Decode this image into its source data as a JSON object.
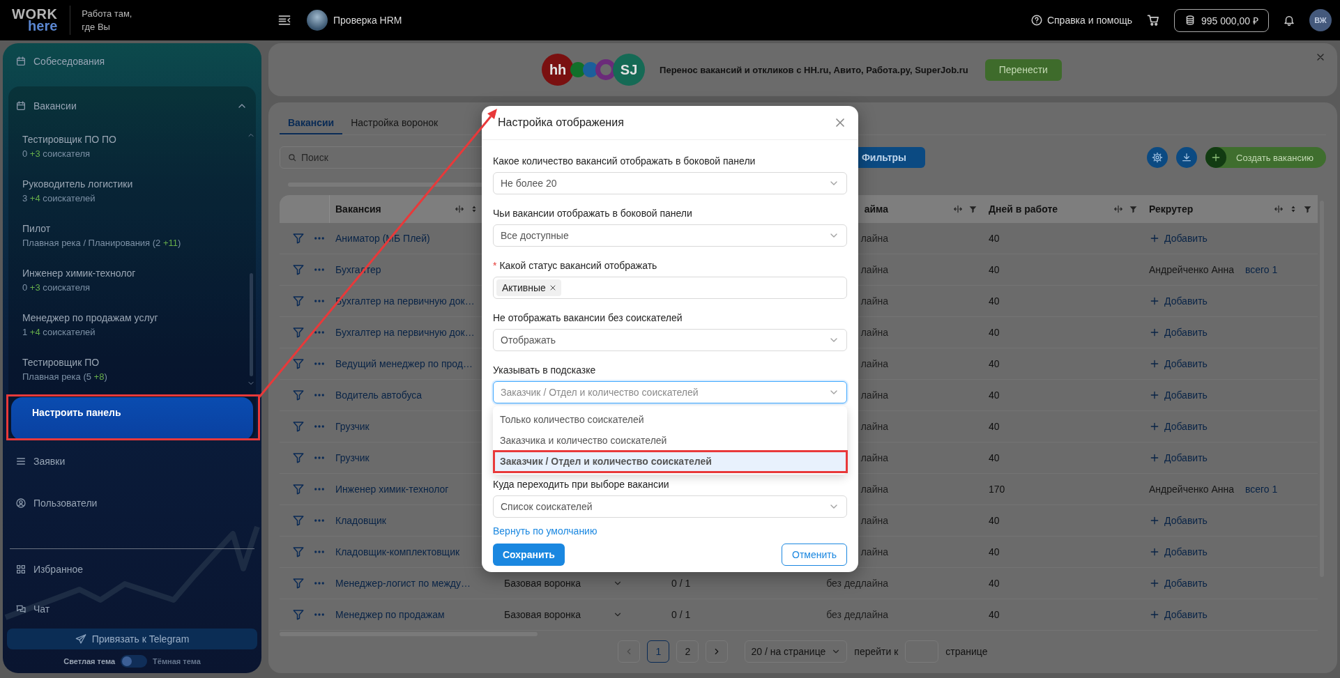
{
  "top_bar": {
    "logo": {
      "line1": "WORK",
      "line2": "here"
    },
    "slogan": [
      "Работа там,",
      "где Вы"
    ],
    "project": "Проверка HRM",
    "help": "Справка и помощь",
    "balance": "995 000,00 ₽",
    "avatar": "ВЖ"
  },
  "sidebar": {
    "items_top": [
      {
        "label": "Собеседования"
      }
    ],
    "group": {
      "label": "Вакансии",
      "expanded": true,
      "items": [
        {
          "title": "Тестировщик ПО ПО",
          "subtitle": {
            "before": "0 ",
            "added": "+3",
            "after": " соискателя"
          }
        },
        {
          "title": "Руководитель логистики",
          "subtitle": {
            "before": "3 ",
            "added": "+4",
            "after": " соискателей"
          }
        },
        {
          "title": "Пилот",
          "subtitle": {
            "before": "Плавная река / Планирования (2 ",
            "added": "+11",
            "after": ")"
          }
        },
        {
          "title": "Инженер химик-технолог",
          "subtitle": {
            "before": "0 ",
            "added": "+3",
            "after": " соискателя"
          }
        },
        {
          "title": "Менеджер по продажам услуг",
          "subtitle": {
            "before": "1 ",
            "added": "+4",
            "after": " соискателей"
          }
        },
        {
          "title": "Тестировщик ПО",
          "subtitle": {
            "before": "Плавная река (5 ",
            "added": "+8",
            "after": ")"
          }
        }
      ]
    },
    "configure_button": "Настроить панель",
    "items_bottom": [
      {
        "label": "Заявки"
      },
      {
        "label": "Пользователи"
      }
    ],
    "items_pinned": [
      {
        "label": "Избранное"
      },
      {
        "label": "Чат"
      }
    ],
    "telegram_button": "Привязать к Telegram",
    "theme": {
      "light_label": "Светлая тема",
      "dark_label": "Тёмная тема",
      "dark": false
    }
  },
  "banner": {
    "logos": [
      {
        "kind": "badge",
        "text": "hh",
        "color": "#7a1010"
      },
      {
        "kind": "dot",
        "color": "#12702a"
      },
      {
        "kind": "dot",
        "color": "#1b5f9b"
      },
      {
        "kind": "ring",
        "color": "#6b2a7a"
      },
      {
        "kind": "badge",
        "text": "SJ",
        "color": "#156a55"
      }
    ],
    "text": "Перенос вакансий и откликов с HH.ru, Авито, Работа.ру, SuperJob.ru",
    "button": "Перенести"
  },
  "tabs": [
    {
      "label": "Вакансии",
      "selected": true
    },
    {
      "label": "Настройка воронок",
      "selected": false
    }
  ],
  "toolbar": {
    "search_placeholder": "Поиск",
    "filters_button": "Фильтры",
    "create_button": "Создать вакансию"
  },
  "table": {
    "columns": [
      {
        "label": "Вакансия",
        "sortable": true
      },
      {},
      {},
      {
        "label": "айма",
        "sortable": false
      },
      {
        "label": "Дней в работе",
        "sortable": false
      },
      {
        "label": "Рекрутер",
        "sortable": true
      }
    ],
    "rows": [
      {
        "vacancy": "Аниматор (МБ Плей)",
        "deadline": "лайна",
        "days": "40",
        "recruiter": {
          "kind": "add",
          "label": "Добавить"
        }
      },
      {
        "vacancy": "Бухгалтер",
        "deadline": "лайна",
        "days": "40",
        "recruiter": {
          "kind": "assigned",
          "name": "Андрейченко Анна",
          "total": "всего 1"
        }
      },
      {
        "vacancy": "Бухгалтер на первичную док…",
        "deadline": "лайна",
        "days": "40",
        "recruiter": {
          "kind": "add",
          "label": "Добавить"
        }
      },
      {
        "vacancy": "Бухгалтер на первичную док…",
        "deadline": "лайна",
        "days": "40",
        "recruiter": {
          "kind": "add",
          "label": "Добавить"
        }
      },
      {
        "vacancy": "Ведущий менеджер по прод…",
        "deadline": "лайна",
        "days": "40",
        "recruiter": {
          "kind": "add",
          "label": "Добавить"
        }
      },
      {
        "vacancy": "Водитель автобуса",
        "deadline": "лайна",
        "days": "40",
        "recruiter": {
          "kind": "add",
          "label": "Добавить"
        }
      },
      {
        "vacancy": "Грузчик",
        "deadline": "лайна",
        "days": "40",
        "recruiter": {
          "kind": "add",
          "label": "Добавить"
        }
      },
      {
        "vacancy": "Грузчик",
        "deadline": "лайна",
        "days": "40",
        "recruiter": {
          "kind": "add",
          "label": "Добавить"
        }
      },
      {
        "vacancy": "Инженер химик-технолог",
        "deadline": "лайна",
        "days": "170",
        "recruiter": {
          "kind": "assigned",
          "name": "Андрейченко Анна",
          "total": "всего 1"
        }
      },
      {
        "vacancy": "Кладовщик",
        "deadline": "лайна",
        "days": "40",
        "recruiter": {
          "kind": "add",
          "label": "Добавить"
        }
      },
      {
        "vacancy": "Кладовщик-комплектовщик",
        "deadline": "лайна",
        "days": "40",
        "recruiter": {
          "kind": "add",
          "label": "Добавить"
        }
      },
      {
        "vacancy": "Менеджер-логист по между…",
        "funnel": "Базовая воронка",
        "progress": "0 / 1",
        "deadline": "без дедлайна",
        "days": "40",
        "recruiter": {
          "kind": "add",
          "label": "Добавить"
        }
      },
      {
        "vacancy": "Менеджер по продажам",
        "funnel": "Базовая воронка",
        "progress": "0 / 1",
        "deadline": "без дедлайна",
        "days": "40",
        "recruiter": {
          "kind": "add",
          "label": "Добавить"
        }
      }
    ]
  },
  "pagination": {
    "prev_disabled": true,
    "pages": [
      {
        "label": "1",
        "selected": true
      },
      {
        "label": "2",
        "selected": false
      }
    ],
    "page_size": "20 / на странице",
    "goto_label": "перейти к",
    "goto_suffix": "странице"
  },
  "dialog": {
    "title": "Настройка отображения",
    "fields": [
      {
        "kind": "select",
        "label": "Какое количество вакансий отображать в боковой панели",
        "value": "Не более 20",
        "open": false
      },
      {
        "kind": "select",
        "label": "Чьи вакансии отображать в боковой панели",
        "value": "Все доступные",
        "open": false
      },
      {
        "kind": "tags",
        "label": "Какой статус вакансий отображать",
        "required_mark": "*",
        "tags": [
          "Активные"
        ]
      },
      {
        "kind": "select",
        "label": "Не отображать вакансии без соискателей",
        "value": "Отображать",
        "open": false
      },
      {
        "kind": "select",
        "label": "Указывать в подсказке",
        "value": "Заказчик / Отдел и количество соискателей",
        "open": true,
        "options": [
          {
            "label": "Только количество соискателей",
            "selected": false
          },
          {
            "label": "Заказчика и количество соискателей",
            "selected": false
          },
          {
            "label": "Заказчик / Отдел и количество соискателей",
            "selected": true
          }
        ]
      },
      {
        "kind": "select",
        "label": "Куда переходить при выборе вакансии",
        "value": "Список соискателей",
        "open": false
      }
    ],
    "reset_link": "Вернуть по умолчанию",
    "save_button": "Сохранить",
    "cancel_button": "Отменить"
  }
}
